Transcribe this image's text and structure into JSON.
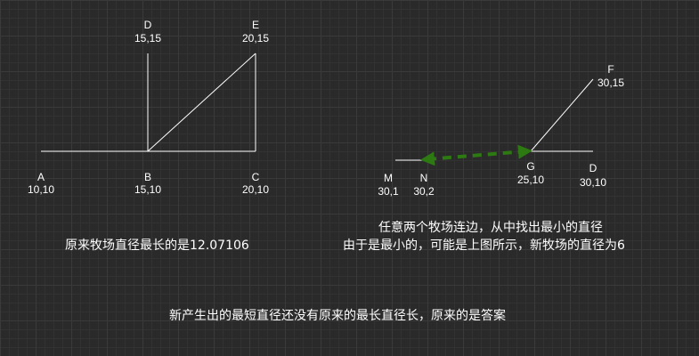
{
  "left_diagram": {
    "points": {
      "A": {
        "name": "A",
        "coord": "10,10"
      },
      "B": {
        "name": "B",
        "coord": "15,10"
      },
      "C": {
        "name": "C",
        "coord": "20,10"
      },
      "D": {
        "name": "D",
        "coord": "15,15"
      },
      "E": {
        "name": "E",
        "coord": "20,15"
      }
    },
    "caption": "原来牧场直径最长的是12.07106"
  },
  "right_diagram": {
    "points": {
      "M": {
        "name": "M",
        "coord": "30,1"
      },
      "N": {
        "name": "N",
        "coord": "30,2"
      },
      "G": {
        "name": "G",
        "coord": "25,10"
      },
      "D": {
        "name": "D",
        "coord": "30,10"
      },
      "F": {
        "name": "F",
        "coord": "30,15"
      }
    },
    "caption_line1": "任意两个牧场连边，从中找出最小的直径",
    "caption_line2": "由于是最小的，可能是上图所示，新牧场的直径为6",
    "arrow_color": "#2d7a12"
  },
  "bottom_note": "新产生出的最短直径还没有原来的最长直径长，原来的是答案",
  "colors": {
    "background": "#2a2a2a",
    "lines": "#ffffff",
    "text": "#ffffff"
  }
}
